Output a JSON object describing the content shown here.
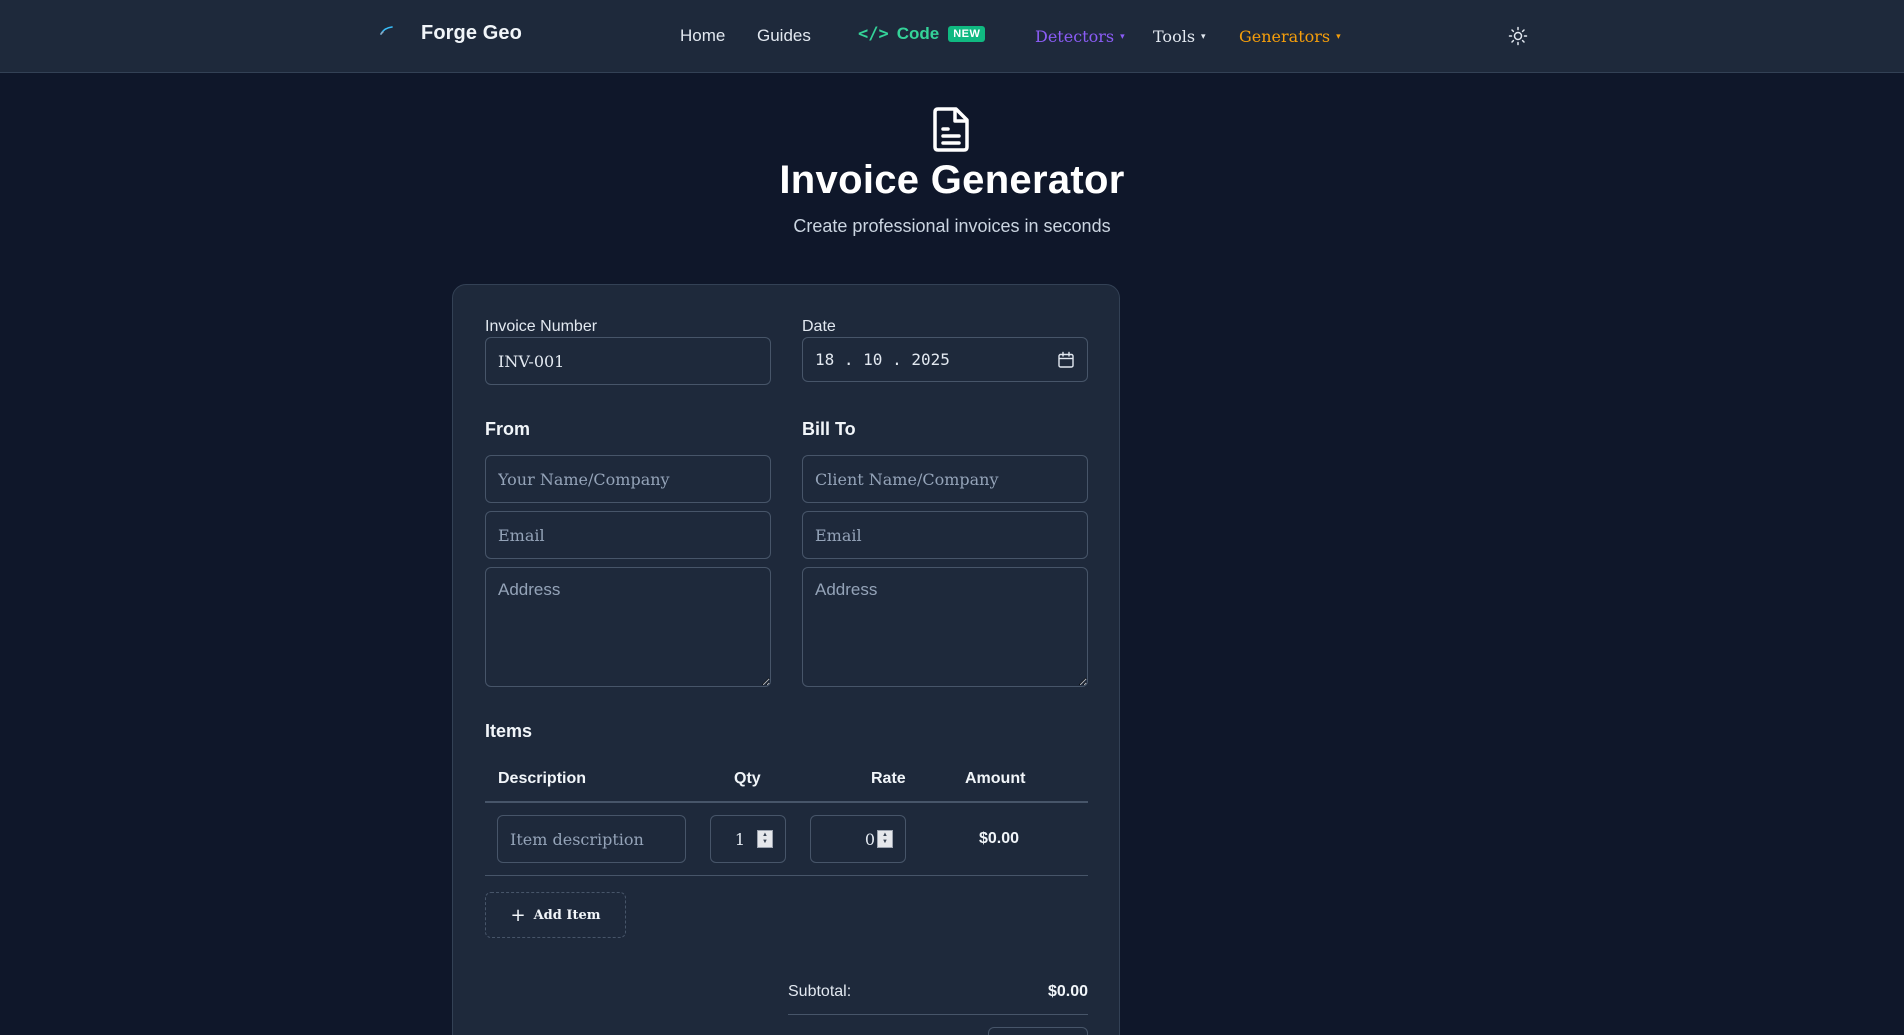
{
  "nav": {
    "brand": "Forge Geo",
    "home": "Home",
    "guides": "Guides",
    "code_glyph": "</>",
    "code": "Code",
    "code_badge": "NEW",
    "detectors": "Detectors",
    "tools": "Tools",
    "generators": "Generators",
    "caret": "▾",
    "theme_icon": "sun-icon"
  },
  "header": {
    "icon": "document-icon",
    "title": "Invoice Generator",
    "subtitle": "Create professional invoices in seconds"
  },
  "form": {
    "invoice_number_label": "Invoice Number",
    "invoice_number_value": "INV-001",
    "date_label": "Date",
    "date_value": "18 . 10 . 2025",
    "from_title": "From",
    "from_name_placeholder": "Your Name/Company",
    "from_email_placeholder": "Email",
    "from_address_placeholder": "Address",
    "billto_title": "Bill To",
    "client_name_placeholder": "Client Name/Company",
    "client_email_placeholder": "Email",
    "client_address_placeholder": "Address"
  },
  "items": {
    "title": "Items",
    "columns": [
      "Description",
      "Qty",
      "Rate",
      "Amount"
    ],
    "rows": [
      {
        "description_placeholder": "Item description",
        "qty": "1",
        "rate": "0",
        "amount": "$0.00"
      }
    ],
    "add_label": "Add Item"
  },
  "totals": {
    "subtotal_label": "Subtotal:",
    "subtotal_value": "$0.00"
  },
  "colors": {
    "background": "#0f172a",
    "surface": "#1e293b",
    "border": "#475569",
    "code_green": "#34d399",
    "detectors_purple": "#8b5cf6",
    "generators_amber": "#f59e0b"
  }
}
